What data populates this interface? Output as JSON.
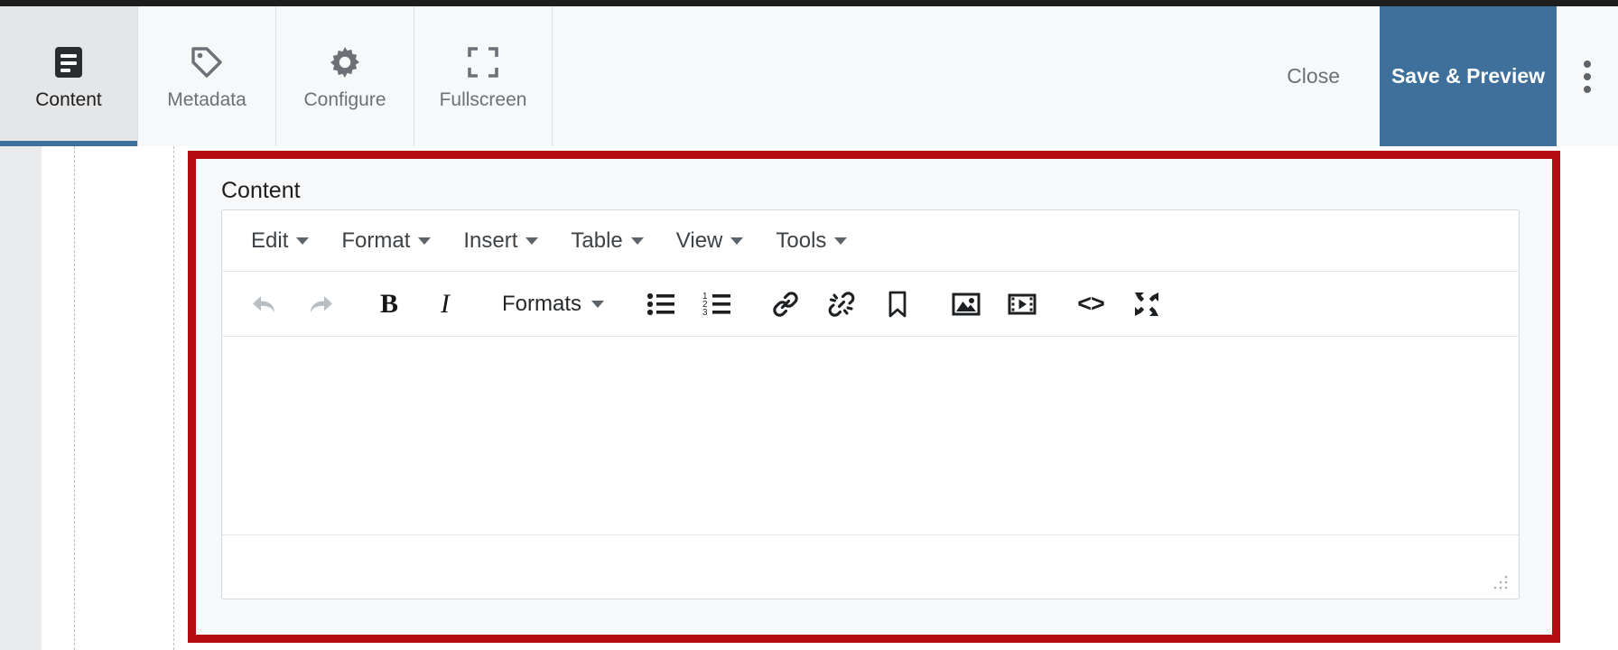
{
  "header": {
    "tabs": [
      {
        "label": "Content",
        "icon": "document-lines-icon",
        "active": true
      },
      {
        "label": "Metadata",
        "icon": "tag-icon",
        "active": false
      },
      {
        "label": "Configure",
        "icon": "gear-icon",
        "active": false
      },
      {
        "label": "Fullscreen",
        "icon": "expand-corners-icon",
        "active": false
      }
    ],
    "close_label": "Close",
    "save_label": "Save & Preview",
    "overflow_icon": "kebab-menu-icon",
    "accent_color": "#3f6f9b"
  },
  "annotation": {
    "highlight_color": "#b50d11"
  },
  "panel": {
    "title": "Content"
  },
  "editor": {
    "menus": [
      {
        "label": "Edit"
      },
      {
        "label": "Format"
      },
      {
        "label": "Insert"
      },
      {
        "label": "Table"
      },
      {
        "label": "View"
      },
      {
        "label": "Tools"
      }
    ],
    "toolbar": [
      {
        "name": "undo-icon",
        "type": "icon",
        "disabled": true
      },
      {
        "name": "redo-icon",
        "type": "icon",
        "disabled": true
      },
      {
        "name": "bold-icon",
        "type": "glyph",
        "glyph": "B"
      },
      {
        "name": "italic-icon",
        "type": "glyph",
        "glyph": "I"
      },
      {
        "name": "formats-dropdown",
        "type": "text",
        "label": "Formats"
      },
      {
        "name": "bullet-list-icon",
        "type": "icon"
      },
      {
        "name": "numbered-list-icon",
        "type": "icon"
      },
      {
        "name": "link-icon",
        "type": "icon"
      },
      {
        "name": "unlink-icon",
        "type": "icon"
      },
      {
        "name": "bookmark-icon",
        "type": "icon"
      },
      {
        "name": "image-icon",
        "type": "icon"
      },
      {
        "name": "media-icon",
        "type": "icon"
      },
      {
        "name": "source-code-icon",
        "type": "glyph",
        "glyph": "<>"
      },
      {
        "name": "fullscreen-icon",
        "type": "icon"
      }
    ],
    "content_text": "",
    "status_text": ""
  }
}
